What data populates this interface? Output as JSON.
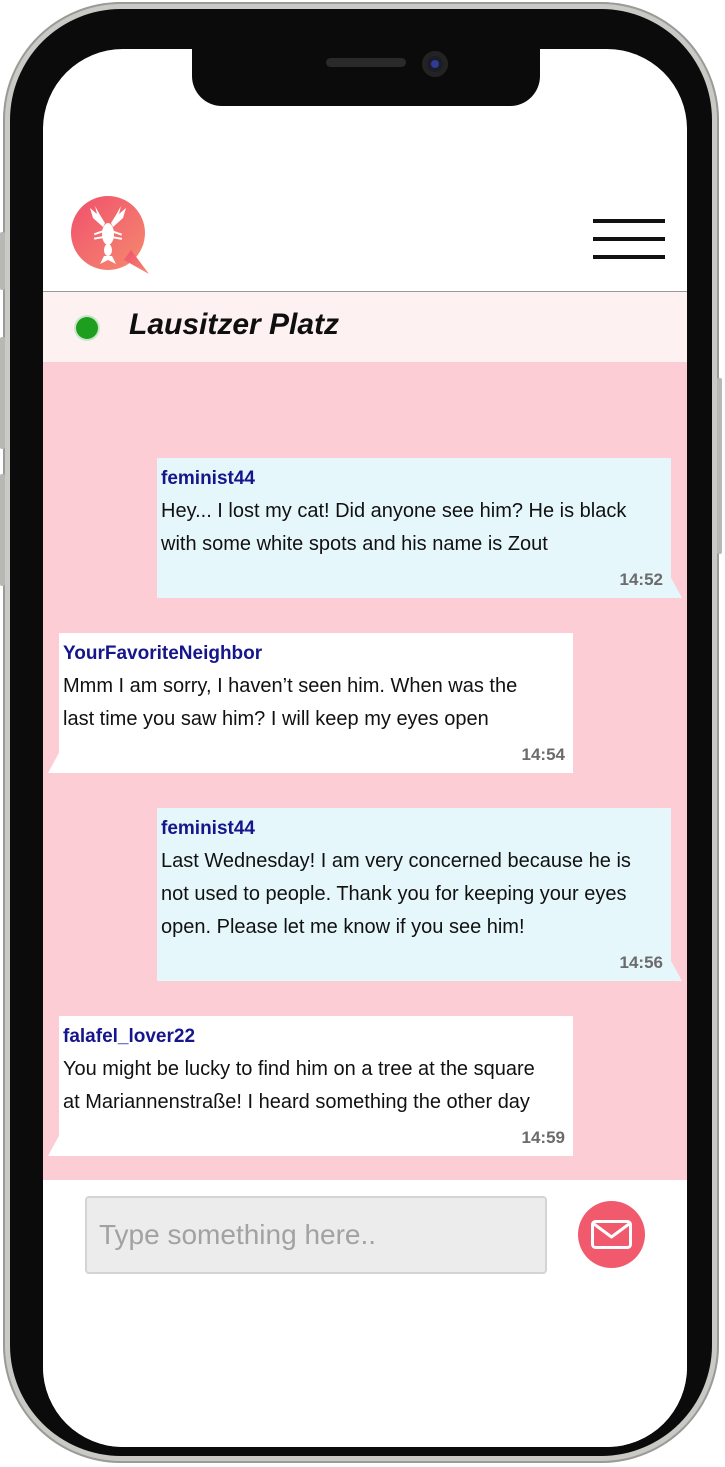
{
  "header": {
    "logo_icon": "lobster-chat-bubble-logo",
    "menu_icon": "hamburger-menu-icon",
    "accent_color": "#f05a6c"
  },
  "room": {
    "name": "Lausitzer Platz",
    "status": "online",
    "status_color": "#1e9e1e"
  },
  "messages": [
    {
      "direction": "outgoing",
      "user": "feminist44",
      "lines": [
        "Hey... I lost my cat! Did anyone see him? He is black",
        "with some white spots and his name is Zout"
      ],
      "time": "14:52"
    },
    {
      "direction": "incoming",
      "user": "YourFavoriteNeighbor",
      "lines": [
        "Mmm I am sorry, I haven’t seen him. When was the",
        "last time you saw him? I will keep my eyes open"
      ],
      "time": "14:54"
    },
    {
      "direction": "outgoing",
      "user": "feminist44",
      "lines": [
        "Last Wednesday! I am very concerned because he is",
        "not used to people. Thank you for keeping your eyes",
        "open. Please let me know if you see him!"
      ],
      "time": "14:56"
    },
    {
      "direction": "incoming",
      "user": "falafel_lover22",
      "lines": [
        "You might be lucky to find him on a tree at the square",
        "at Mariannenstraße! I heard something the other day"
      ],
      "time": "14:59"
    }
  ],
  "composer": {
    "placeholder": "Type something here..",
    "value": "",
    "send_icon": "envelope-icon"
  },
  "colors": {
    "chat_background": "#fccdd5",
    "outgoing_bubble": "#e6f7fc",
    "incoming_bubble": "#ffffff",
    "username": "#15158c"
  }
}
